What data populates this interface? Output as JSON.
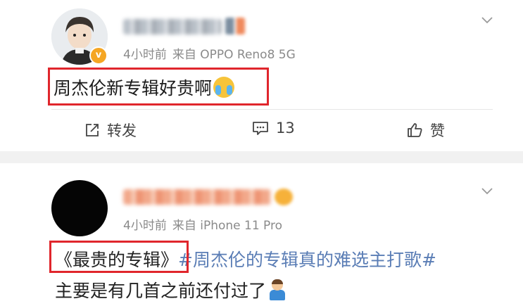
{
  "posts": [
    {
      "time": "4小时前",
      "source": "来自 OPPO Reno8 5G",
      "text": "周杰伦新专辑好贵啊",
      "emoji": "crying-face",
      "actions": {
        "share": "转发",
        "comment_count": "13",
        "like": "赞"
      }
    },
    {
      "time": "4小时前",
      "source": "来自 iPhone 11 Pro",
      "title": "《最贵的专辑》",
      "topic": "#周杰伦的专辑真的难选主打歌#",
      "line2": "主要是有几首之前还付过了",
      "emoji": "person-raising-hand"
    }
  ],
  "colors": {
    "highlight_box": "#e0262c",
    "topic": "#5a7db5",
    "meta": "#8a8a8a",
    "badge": "#f5a623"
  }
}
